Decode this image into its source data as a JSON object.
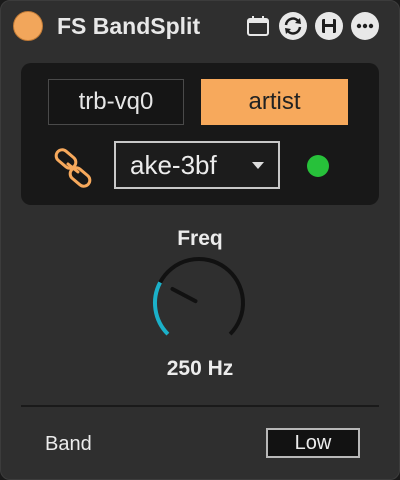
{
  "device": {
    "title": "FS BandSplit",
    "power_on": true,
    "accent_color": "#f7a95c"
  },
  "toolbar": {
    "icons": [
      "calendar-icon",
      "refresh-icon",
      "save-icon",
      "more-icon"
    ]
  },
  "panel": {
    "left_box": "trb-vq0",
    "right_box": "artist",
    "link_icon": "link-icon",
    "dropdown_value": "ake-3bf",
    "status_led_color": "#27c13a"
  },
  "freq": {
    "label": "Freq",
    "value_text": "250 Hz",
    "knob_fraction": 0.27
  },
  "band": {
    "label": "Band",
    "value": "Low"
  }
}
